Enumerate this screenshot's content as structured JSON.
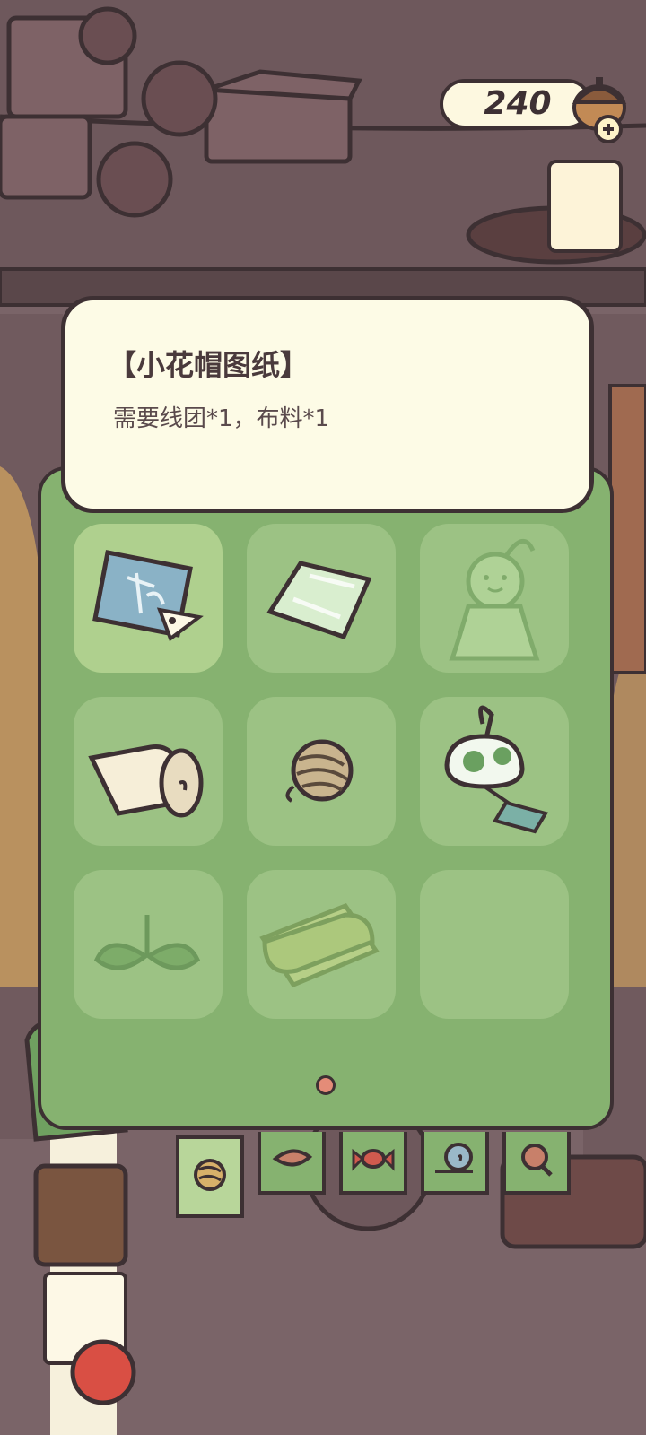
{
  "currency": {
    "amount": "240",
    "icon": "acorn-plus-icon"
  },
  "tooltip": {
    "title": "【小花帽图纸】",
    "description": "需要线团*1，布料*1"
  },
  "inventory": {
    "items": [
      {
        "name": "blueprint",
        "icon": "blueprint-scroll-icon",
        "selected": true
      },
      {
        "name": "glass",
        "icon": "glass-pane-icon"
      },
      {
        "name": "teru-teru-bozu",
        "icon": "teru-teru-bozu-icon"
      },
      {
        "name": "paper-roll",
        "icon": "paper-roll-icon"
      },
      {
        "name": "yarn-ball",
        "icon": "yarn-ball-icon"
      },
      {
        "name": "wind-chime",
        "icon": "wind-chime-icon"
      },
      {
        "name": "leaf-sprout",
        "icon": "leaf-sprout-icon"
      },
      {
        "name": "fabric-roll",
        "icon": "fabric-roll-icon"
      },
      {
        "name": "empty",
        "icon": ""
      }
    ],
    "page_indicator": "1"
  },
  "tabs": [
    {
      "name": "materials",
      "icon": "yarn-tab-icon",
      "active": true
    },
    {
      "name": "food",
      "icon": "leaf-food-tab-icon"
    },
    {
      "name": "candy",
      "icon": "candy-tab-icon"
    },
    {
      "name": "snail",
      "icon": "snail-tab-icon"
    },
    {
      "name": "search",
      "icon": "magnifier-tab-icon"
    }
  ],
  "colors": {
    "panel_green": "#86b270",
    "slot_green": "#9cc284",
    "outline": "#3d3033",
    "tooltip_bg": "#fdfbe6",
    "background": "#7a6468"
  }
}
